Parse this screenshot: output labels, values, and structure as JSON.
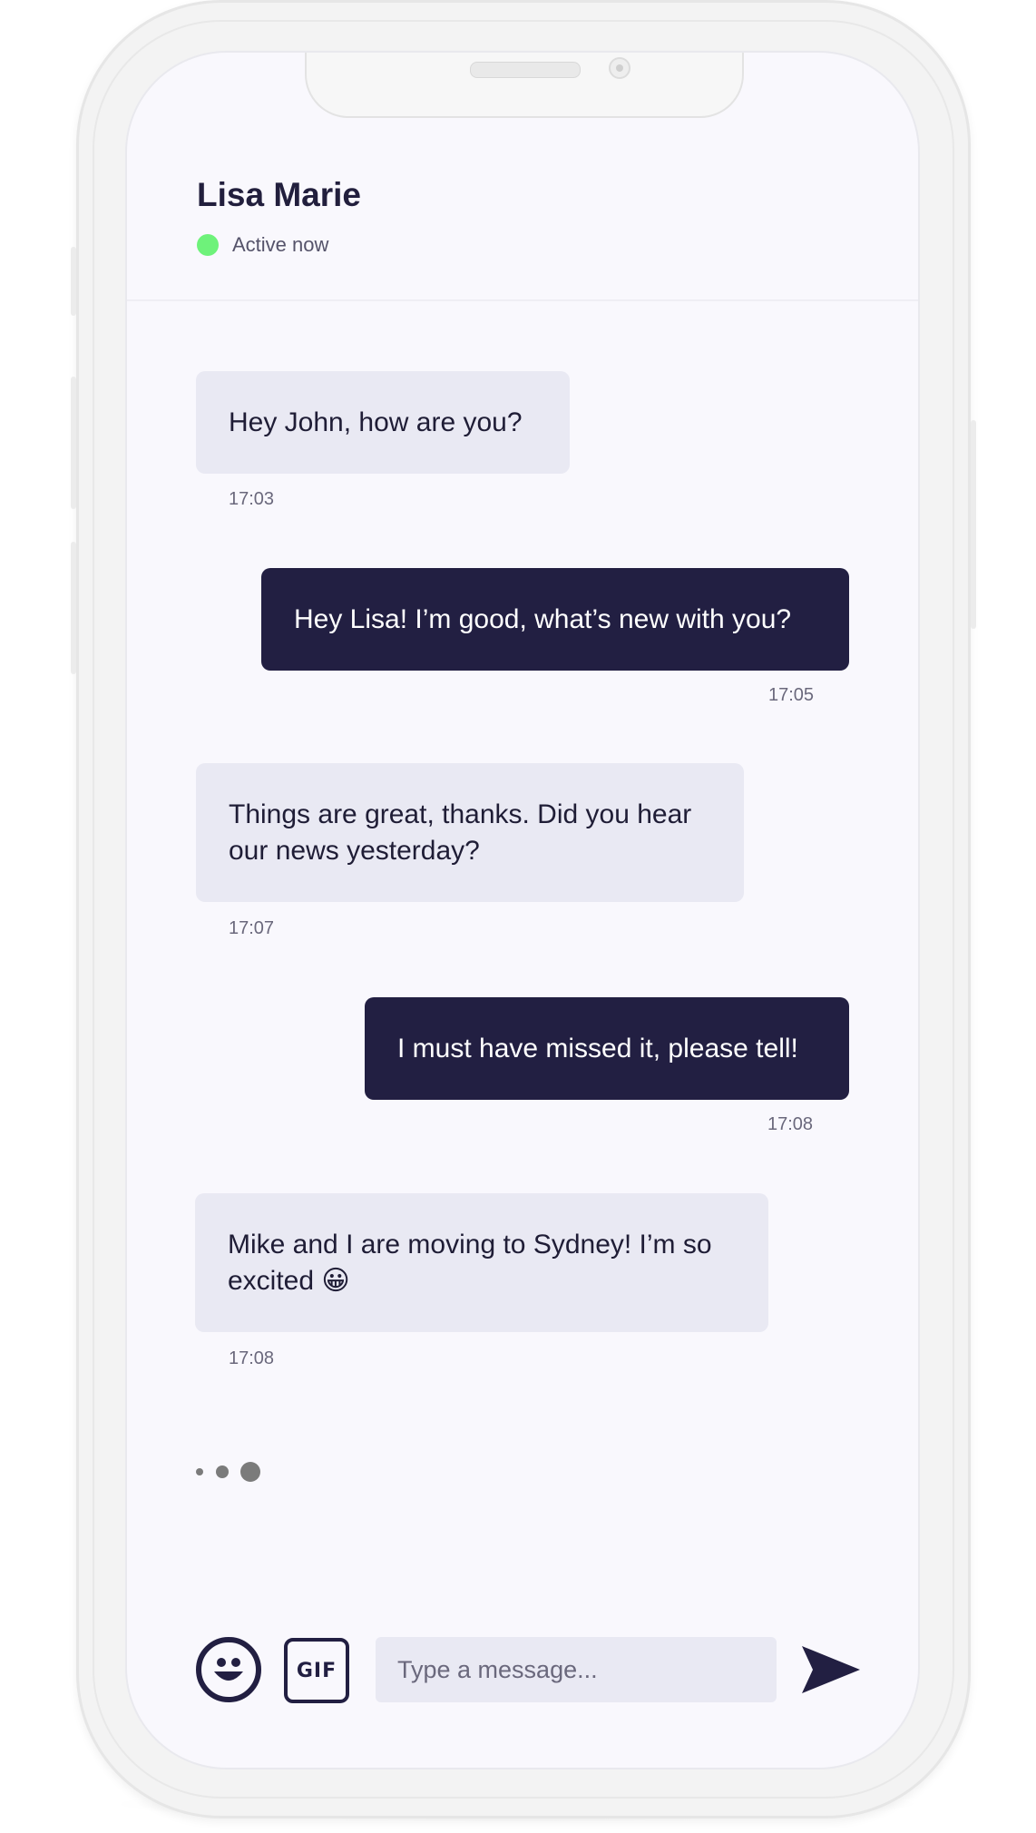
{
  "contact": {
    "name": "Lisa Marie",
    "status": "Active now",
    "status_color": "#6ef27a"
  },
  "messages": [
    {
      "direction": "incoming",
      "text": "Hey John, how are you?",
      "time": "17:03"
    },
    {
      "direction": "outgoing",
      "text": "Hey Lisa! I’m good, what’s new with you?",
      "time": "17:05"
    },
    {
      "direction": "incoming",
      "text": "Things are great, thanks. Did you hear our news yesterday?",
      "time": "17:07"
    },
    {
      "direction": "outgoing",
      "text": "I must have missed it, please tell!",
      "time": "17:08"
    },
    {
      "direction": "incoming",
      "text": "Mike and I are moving to Sydney! I’m so excited 😀",
      "time": "17:08"
    }
  ],
  "composer": {
    "emoji_icon": "smiley-face-icon",
    "gif_label": "GIF",
    "placeholder": "Type a message...",
    "send_icon": "send-arrow-icon"
  },
  "colors": {
    "brand_dark": "#221f42",
    "incoming_bubble": "#e9e9f3",
    "screen_background": "#f9f8fd"
  }
}
